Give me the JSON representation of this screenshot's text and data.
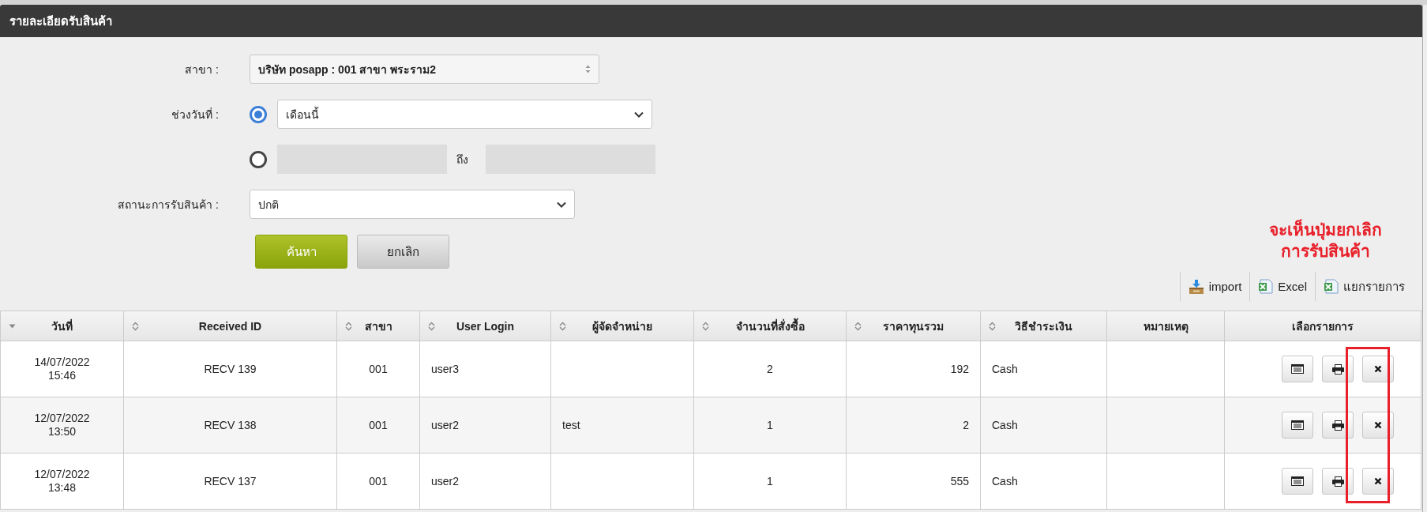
{
  "header": {
    "title": "รายละเอียดรับสินค้า"
  },
  "filters": {
    "branch": {
      "label": "สาขา :",
      "value": "บริษัท posapp : 001 สาขา พระราม2"
    },
    "date_range": {
      "label": "ช่วงวันที่ :",
      "options": [
        {
          "kind": "preset",
          "selected": true,
          "value": "เดือนนี้"
        },
        {
          "kind": "range",
          "selected": false,
          "separator": "ถึง"
        }
      ]
    },
    "status": {
      "label": "สถานะการรับสินค้า :",
      "value": "ปกติ"
    },
    "buttons": [
      {
        "label": "ค้นหา",
        "kind": "primary"
      },
      {
        "label": "ยกเลิก",
        "kind": "secondary"
      }
    ]
  },
  "annotation": {
    "text": "จะเห็นปุ่มยกเลิก\nการรับสินค้า"
  },
  "toolbar": [
    {
      "label": "import",
      "kind": "import"
    },
    {
      "label": "Excel",
      "kind": "excel"
    },
    {
      "label": "แยกรายการ",
      "kind": "excel"
    }
  ],
  "table": {
    "columns": [
      {
        "label": "วันที่",
        "sortable": true,
        "sorted": true
      },
      {
        "label": "Received ID",
        "sortable": true,
        "sorted": false
      },
      {
        "label": "สาขา",
        "sortable": true,
        "sorted": false
      },
      {
        "label": "User Login",
        "sortable": true,
        "sorted": false
      },
      {
        "label": "ผู้จัดจำหน่าย",
        "sortable": true,
        "sorted": false
      },
      {
        "label": "จำนวนที่สั่งซื้อ",
        "sortable": true,
        "sorted": false
      },
      {
        "label": "ราคาทุนรวม",
        "sortable": true,
        "sorted": false
      },
      {
        "label": "วิธีชำระเงิน",
        "sortable": true,
        "sorted": false
      },
      {
        "label": "หมายเหตุ",
        "sortable": false,
        "sorted": false
      },
      {
        "label": "เลือกรายการ",
        "sortable": false,
        "sorted": false
      }
    ],
    "rows": [
      {
        "cells": [
          "14/07/2022\n15:46",
          "RECV 139",
          "001",
          "user3",
          "",
          "2",
          "192",
          "Cash",
          ""
        ]
      },
      {
        "cells": [
          "12/07/2022\n13:50",
          "RECV 138",
          "001",
          "user2",
          "test",
          "1",
          "2",
          "Cash",
          ""
        ]
      },
      {
        "cells": [
          "12/07/2022\n13:48",
          "RECV 137",
          "001",
          "user2",
          "",
          "1",
          "555",
          "Cash",
          ""
        ]
      }
    ]
  }
}
